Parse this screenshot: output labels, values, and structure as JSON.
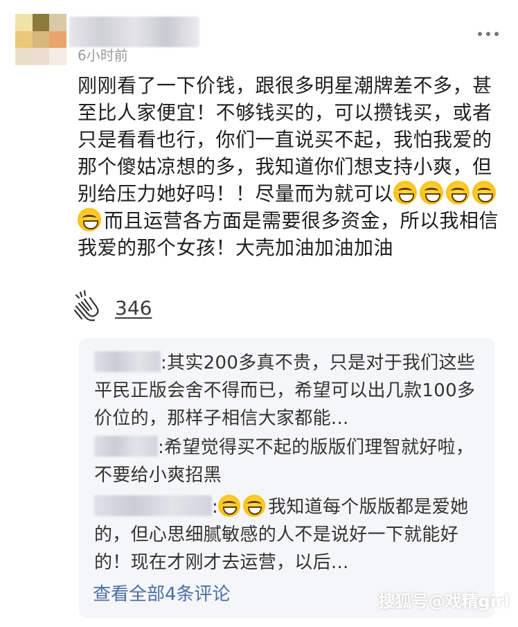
{
  "comment": {
    "timestamp": "6小时前",
    "text_part1": "刚刚看了一下价钱，跟很多明星潮牌差不多，甚至比人家便宜！不够钱买的，可以攒钱买，或者只是看看也行，你们一直说买不起，我怕我爱的那个傻姑凉想的多，我知道你们想支持小爽，但别给压力她好吗！！尽量而为就可以",
    "emoji_count": 5,
    "text_part2": "而且运营各方面是需要很多资金，所以我相信我爱的那个女孩！大壳加油加油加油",
    "like_count": "346",
    "icons": {
      "clap": "clapping-hands-icon",
      "more": "more-options-icon",
      "emoji": "grinning-face-emoji"
    }
  },
  "replies": [
    {
      "text": ":其实200多真不贵，只是对于我们这些平民正版会舍不得而已，希望可以出几款100多价位的，那样子相信大家都能..."
    },
    {
      "text": ":希望觉得买不起的版版们理智就好啦，不要给小爽招黑"
    },
    {
      "text": "我知道每个版版都是爱她的，但心思细腻敏感的人不是说好一下就能好的！现在才刚才去运营，以后..."
    }
  ],
  "view_all_label": "查看全部4条评论",
  "watermark": "搜狐号@戏精girl",
  "colors": {
    "link": "#4a6fa5",
    "reply_bg": "#f5f6f8",
    "meta_text": "#9a9a9a"
  }
}
